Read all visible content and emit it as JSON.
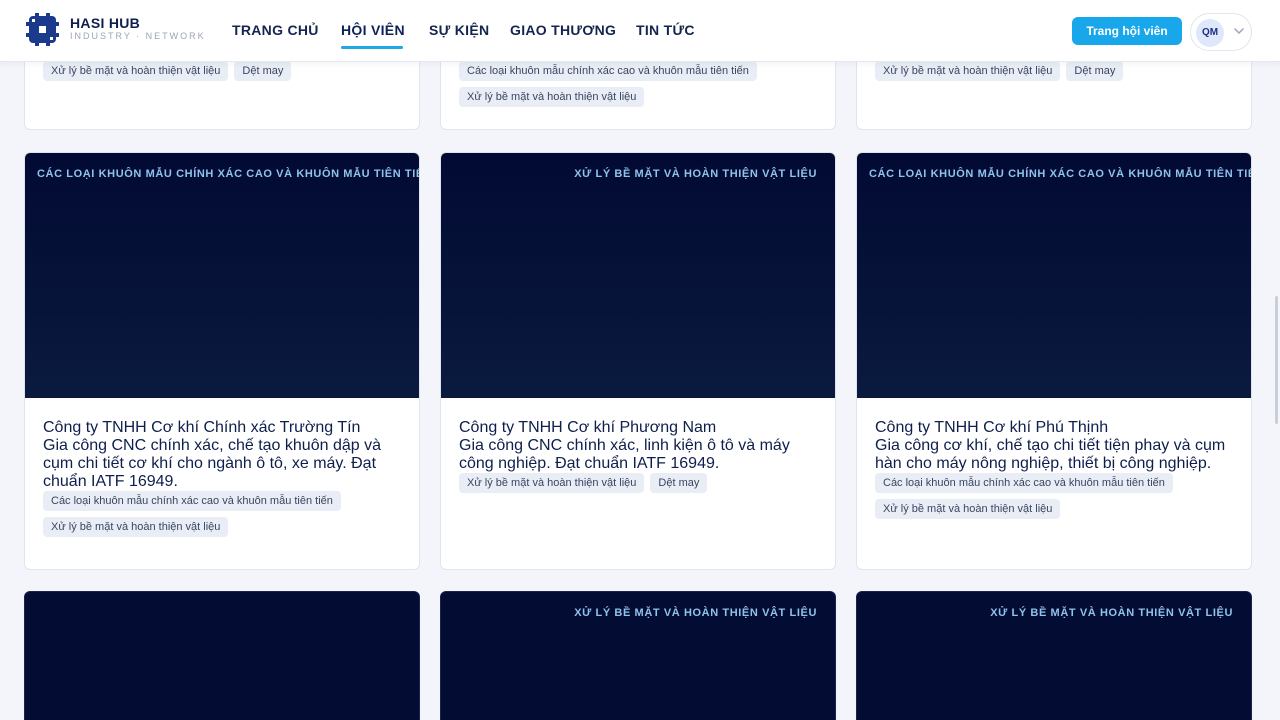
{
  "header": {
    "brand": "HASI HUB",
    "brand_sub": "INDUSTRY · NETWORK",
    "nav": [
      "TRANG CHỦ",
      "HỘI VIÊN",
      "SỰ KIỆN",
      "GIAO THƯƠNG",
      "TIN TỨC"
    ],
    "active_nav": "HỘI VIÊN",
    "cta": "Trang hội viên",
    "avatar_initials": "QM"
  },
  "top_cards": [
    {
      "tags": [
        "Xử lý bề mặt và hoàn thiện vật liệu",
        "Dệt may"
      ]
    },
    {
      "tags": [
        "Các loại khuôn mẫu chính xác cao và khuôn mẫu tiên tiến",
        "Xử lý bề mặt và hoàn thiện vật liệu"
      ]
    },
    {
      "tags": [
        "Xử lý bề mặt và hoàn thiện vật liệu",
        "Dệt may"
      ]
    }
  ],
  "mid_cards": [
    {
      "category": "CÁC LOẠI KHUÔN MẪU CHÍNH XÁC CAO VÀ KHUÔN MẪU TIÊN TIẾN",
      "title": "Công ty TNHH Cơ khí Chính xác Trường Tín",
      "desc": "Gia công CNC chính xác, chế tạo khuôn dập và cụm chi tiết cơ khí cho ngành ô tô, xe máy. Đạt chuẩn IATF 16949.",
      "tags": [
        "Các loại khuôn mẫu chính xác cao và khuôn mẫu tiên tiến",
        "Xử lý bề mặt và hoàn thiện vật liệu"
      ]
    },
    {
      "category": "XỬ LÝ BỀ MẶT VÀ HOÀN THIỆN VẬT LIỆU",
      "title": "Công ty TNHH Cơ khí Phương Nam",
      "desc": "Gia công CNC chính xác, linh kiện ô tô và máy công nghiệp. Đạt chuẩn IATF 16949.",
      "tags": [
        "Xử lý bề mặt và hoàn thiện vật liệu",
        "Dệt may"
      ]
    },
    {
      "category": "CÁC LOẠI KHUÔN MẪU CHÍNH XÁC CAO VÀ KHUÔN MẪU TIÊN TIẾN",
      "title": "Công ty TNHH Cơ khí Phú Thịnh",
      "desc": "Gia công cơ khí, chế tạo chi tiết tiện phay và cụm hàn cho máy nông nghiệp, thiết bị công nghiệp.",
      "tags": [
        "Các loại khuôn mẫu chính xác cao và khuôn mẫu tiên tiến",
        "Xử lý bề mặt và hoàn thiện vật liệu"
      ]
    }
  ],
  "bottom_cards": [
    {
      "category": ""
    },
    {
      "category": "XỬ LÝ BỀ MẶT VÀ HOÀN THIỆN VẬT LIỆU"
    },
    {
      "category": "XỬ LÝ BỀ MẶT VÀ HOÀN THIỆN VẬT LIỆU"
    }
  ],
  "colors": {
    "accent": "#19a7eb",
    "card_image": "#030d33",
    "brand_dark": "#0f1f4d"
  }
}
